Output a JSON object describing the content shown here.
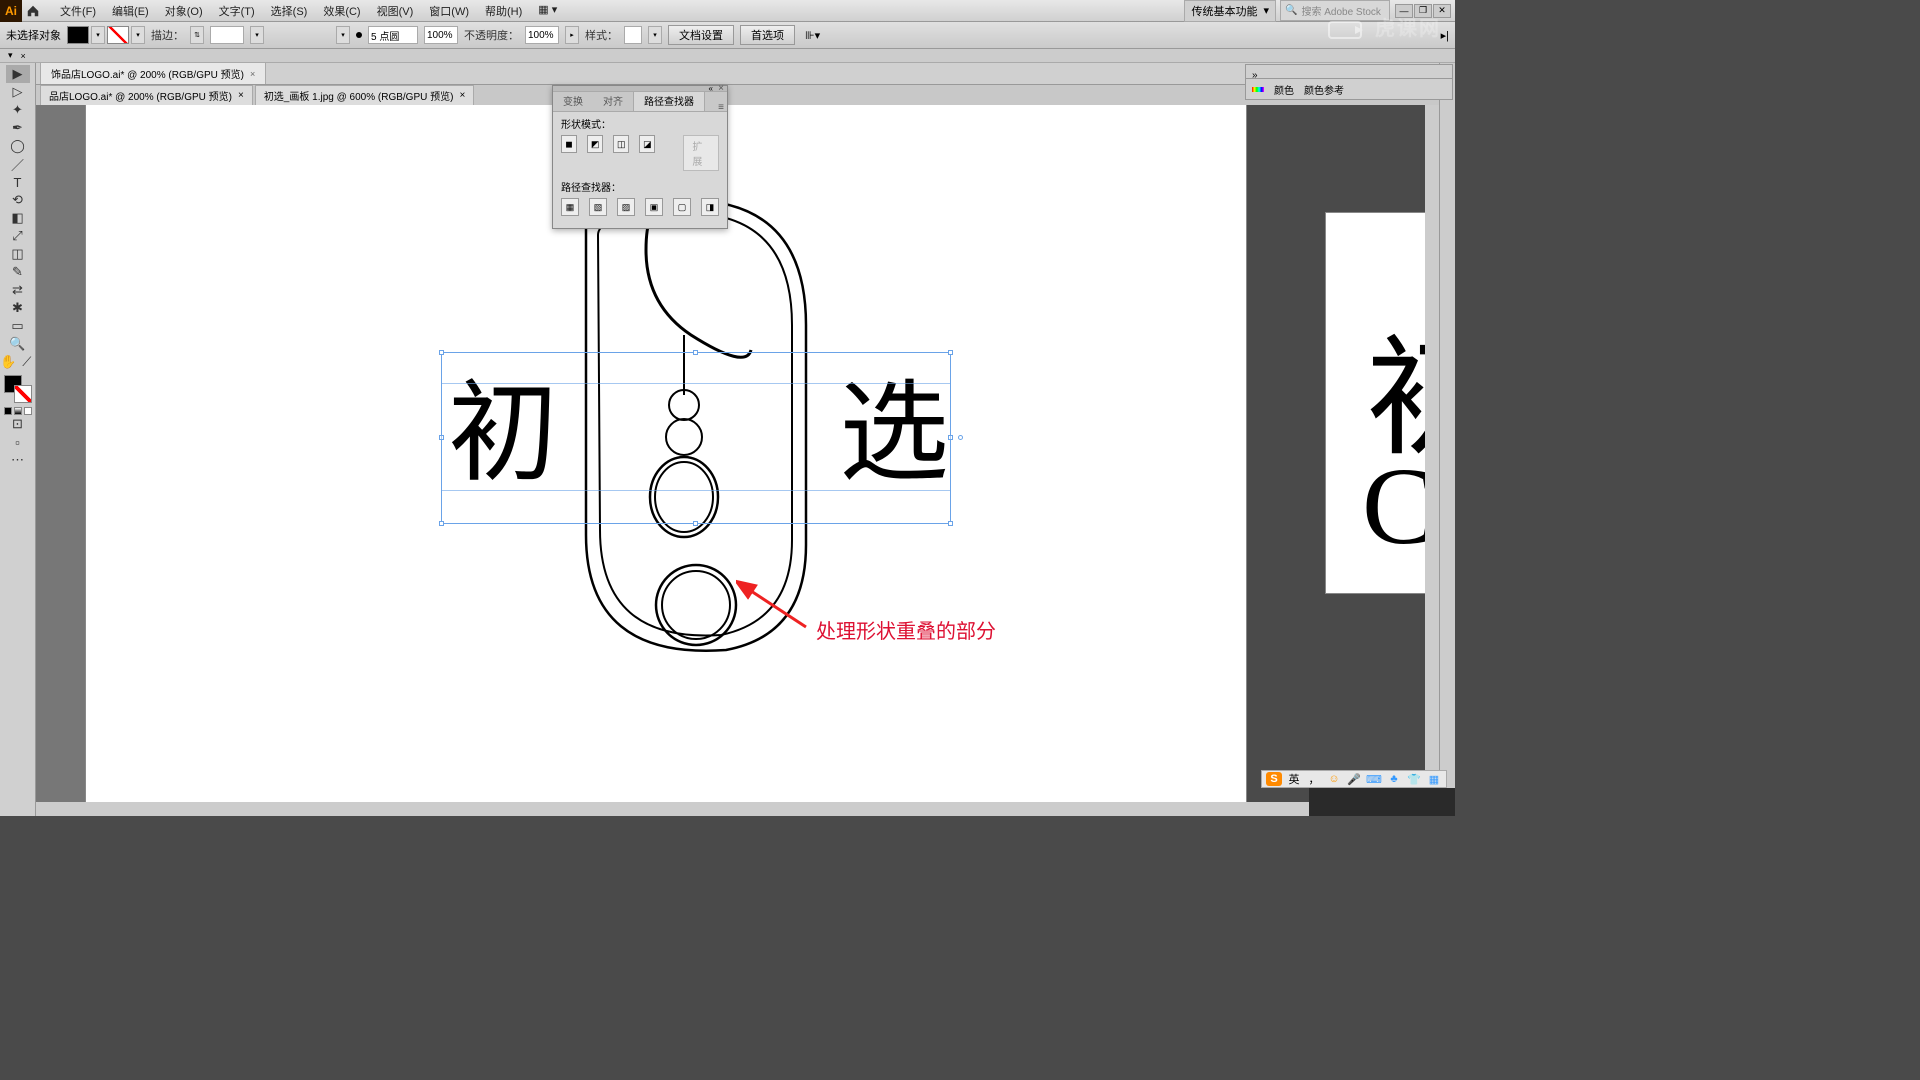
{
  "app": {
    "logo": "Ai"
  },
  "menu": {
    "file": "文件(F)",
    "edit": "编辑(E)",
    "object": "对象(O)",
    "type": "文字(T)",
    "select": "选择(S)",
    "effect": "效果(C)",
    "view": "视图(V)",
    "window": "窗口(W)",
    "help": "帮助(H)"
  },
  "workspace_dd": "传统基本功能",
  "search_placeholder": "搜索 Adobe Stock",
  "controlbar": {
    "no_selection": "未选择对象",
    "stroke_label": "描边：",
    "stroke_dd": "",
    "stroke_size": "5 点圆",
    "opacity_label": "不透明度：",
    "opacity_val": "100%",
    "opacity_val2": "100%",
    "style_label": "样式：",
    "doc_setup": "文档设置",
    "prefs": "首选项"
  },
  "doc_tabs": {
    "tab1": "饰品店LOGO.ai* @ 200% (RGB/GPU 预览)",
    "tab2a": "品店LOGO.ai* @ 200% (RGB/GPU 预览)",
    "tab2b": "初选_画板 1.jpg @ 600% (RGB/GPU 预览)"
  },
  "pathfinder": {
    "tab_transform": "变换",
    "tab_align": "对齐",
    "tab_pathfinder": "路径查找器",
    "shape_modes": "形状模式：",
    "pathfinders": "路径查找器：",
    "expand": "扩展"
  },
  "collapsed_panel": {
    "swatch": "颜色",
    "swatch2": "颜色参考"
  },
  "canvas": {
    "text_left": "初",
    "text_right": "选",
    "side_line1": "初",
    "side_line2": "CH",
    "annotation": "处理形状重叠的部分"
  },
  "ime": {
    "lang": "英",
    "comma": "，"
  },
  "watermark": "虎课网"
}
